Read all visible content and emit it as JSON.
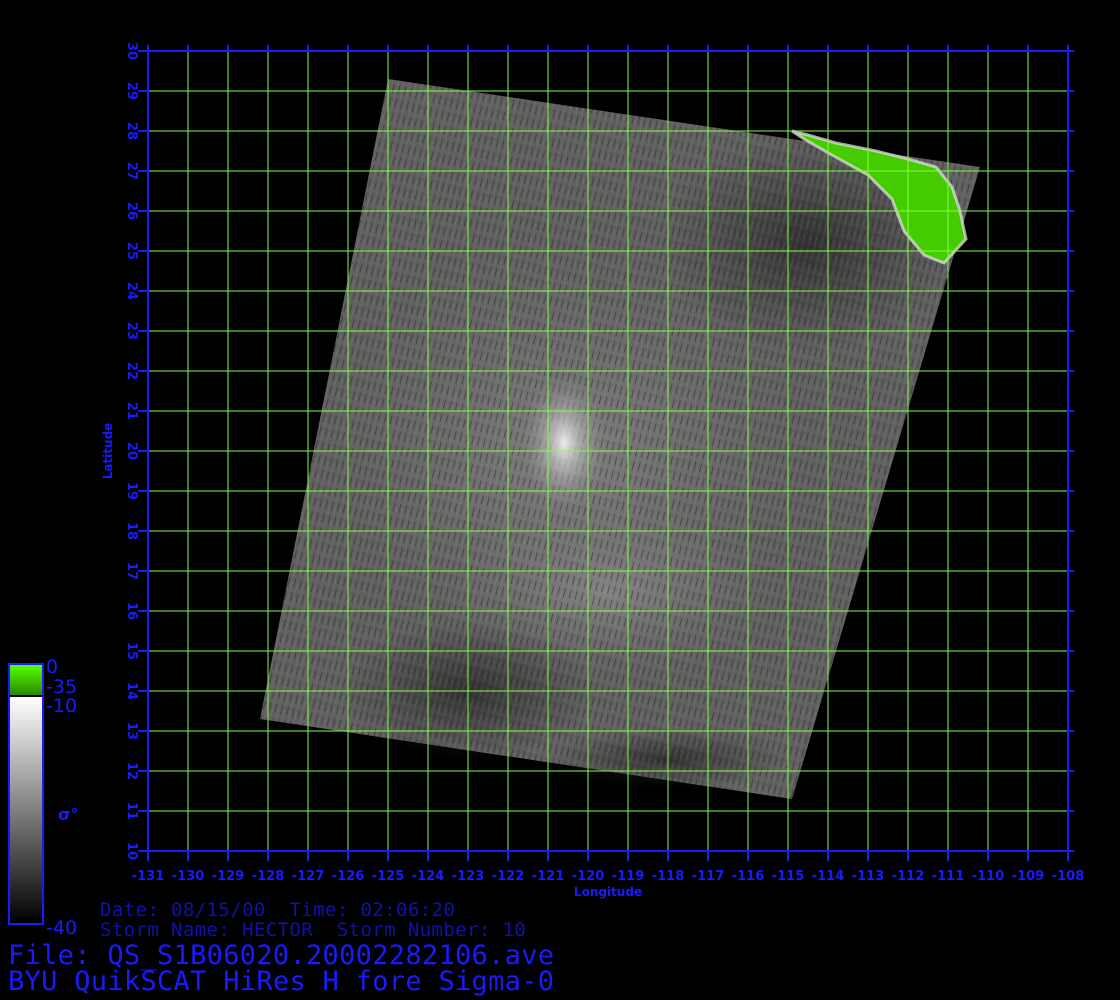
{
  "colors": {
    "axis": "#1a1aff",
    "grid": "#80ff40",
    "land": "#44cc00",
    "info_text": "#1111aa",
    "file_text": "#1a1aff",
    "background": "#000000"
  },
  "map": {
    "xlabel": "Longitude",
    "ylabel": "Latitude",
    "lon_range": [
      -131,
      -108
    ],
    "lat_range": [
      10,
      30
    ],
    "lon_ticks": [
      "-131",
      "-130",
      "-129",
      "-128",
      "-127",
      "-126",
      "-125",
      "-124",
      "-123",
      "-122",
      "-121",
      "-120",
      "-119",
      "-118",
      "-117",
      "-116",
      "-115",
      "-114",
      "-113",
      "-112",
      "-111",
      "-110",
      "-109",
      "-108"
    ],
    "lat_ticks": [
      "10",
      "11",
      "12",
      "13",
      "14",
      "15",
      "16",
      "17",
      "18",
      "19",
      "20",
      "21",
      "22",
      "23",
      "24",
      "25",
      "26",
      "27",
      "28",
      "29",
      "30"
    ],
    "grid": true,
    "swath_corners_lonlat": [
      [
        -125,
        29.3
      ],
      [
        -110.2,
        27.1
      ],
      [
        -114.9,
        11.3
      ],
      [
        -128.2,
        13.3
      ]
    ],
    "storm_bright_center_lonlat": [
      -120.6,
      20.2
    ],
    "land_region": "Baja California (green, top-right)"
  },
  "colorbar": {
    "labels": [
      "0",
      "-35",
      "-10",
      "-40"
    ],
    "symbol": "σ°",
    "green_range": [
      0,
      -35
    ],
    "gray_range": [
      -10,
      -40
    ]
  },
  "info": {
    "line1": "Date: 08/15/00  Time: 02:06:20",
    "line2": "Storm Name: HECTOR  Storm Number: 10"
  },
  "file": {
    "line1": "File: QS_S1B06020.20002282106.ave",
    "line2": "BYU QuikSCAT HiRes H fore Sigma-0"
  }
}
